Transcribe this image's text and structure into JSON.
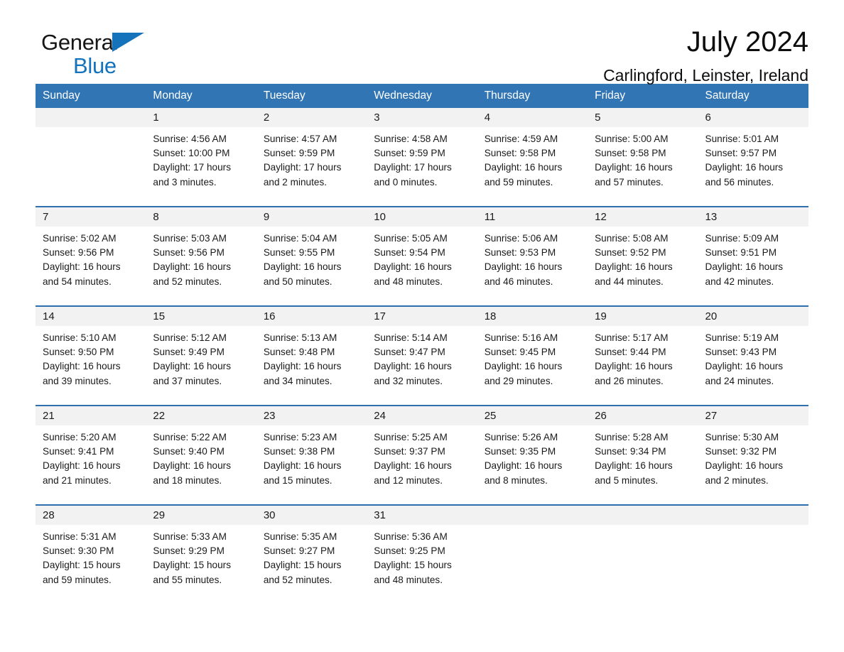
{
  "brand": {
    "name_part1": "General",
    "name_part2": "Blue",
    "accent_color": "#1573bb",
    "flag_icon": "triangle-flag-icon"
  },
  "header": {
    "title": "July 2024",
    "subtitle": "Carlingford, Leinster, Ireland"
  },
  "calendar": {
    "header_bg": "#3275b5",
    "row_divider_color": "#2f6fae",
    "daynum_band_bg": "#f2f2f2",
    "weekday_headers": [
      "Sunday",
      "Monday",
      "Tuesday",
      "Wednesday",
      "Thursday",
      "Friday",
      "Saturday"
    ],
    "weeks": [
      [
        {
          "day": "",
          "sunrise": "",
          "sunset": "",
          "daylight_line1": "",
          "daylight_line2": "",
          "blank": true
        },
        {
          "day": "1",
          "sunrise": "Sunrise: 4:56 AM",
          "sunset": "Sunset: 10:00 PM",
          "daylight_line1": "Daylight: 17 hours",
          "daylight_line2": "and 3 minutes."
        },
        {
          "day": "2",
          "sunrise": "Sunrise: 4:57 AM",
          "sunset": "Sunset: 9:59 PM",
          "daylight_line1": "Daylight: 17 hours",
          "daylight_line2": "and 2 minutes."
        },
        {
          "day": "3",
          "sunrise": "Sunrise: 4:58 AM",
          "sunset": "Sunset: 9:59 PM",
          "daylight_line1": "Daylight: 17 hours",
          "daylight_line2": "and 0 minutes."
        },
        {
          "day": "4",
          "sunrise": "Sunrise: 4:59 AM",
          "sunset": "Sunset: 9:58 PM",
          "daylight_line1": "Daylight: 16 hours",
          "daylight_line2": "and 59 minutes."
        },
        {
          "day": "5",
          "sunrise": "Sunrise: 5:00 AM",
          "sunset": "Sunset: 9:58 PM",
          "daylight_line1": "Daylight: 16 hours",
          "daylight_line2": "and 57 minutes."
        },
        {
          "day": "6",
          "sunrise": "Sunrise: 5:01 AM",
          "sunset": "Sunset: 9:57 PM",
          "daylight_line1": "Daylight: 16 hours",
          "daylight_line2": "and 56 minutes."
        }
      ],
      [
        {
          "day": "7",
          "sunrise": "Sunrise: 5:02 AM",
          "sunset": "Sunset: 9:56 PM",
          "daylight_line1": "Daylight: 16 hours",
          "daylight_line2": "and 54 minutes."
        },
        {
          "day": "8",
          "sunrise": "Sunrise: 5:03 AM",
          "sunset": "Sunset: 9:56 PM",
          "daylight_line1": "Daylight: 16 hours",
          "daylight_line2": "and 52 minutes."
        },
        {
          "day": "9",
          "sunrise": "Sunrise: 5:04 AM",
          "sunset": "Sunset: 9:55 PM",
          "daylight_line1": "Daylight: 16 hours",
          "daylight_line2": "and 50 minutes."
        },
        {
          "day": "10",
          "sunrise": "Sunrise: 5:05 AM",
          "sunset": "Sunset: 9:54 PM",
          "daylight_line1": "Daylight: 16 hours",
          "daylight_line2": "and 48 minutes."
        },
        {
          "day": "11",
          "sunrise": "Sunrise: 5:06 AM",
          "sunset": "Sunset: 9:53 PM",
          "daylight_line1": "Daylight: 16 hours",
          "daylight_line2": "and 46 minutes."
        },
        {
          "day": "12",
          "sunrise": "Sunrise: 5:08 AM",
          "sunset": "Sunset: 9:52 PM",
          "daylight_line1": "Daylight: 16 hours",
          "daylight_line2": "and 44 minutes."
        },
        {
          "day": "13",
          "sunrise": "Sunrise: 5:09 AM",
          "sunset": "Sunset: 9:51 PM",
          "daylight_line1": "Daylight: 16 hours",
          "daylight_line2": "and 42 minutes."
        }
      ],
      [
        {
          "day": "14",
          "sunrise": "Sunrise: 5:10 AM",
          "sunset": "Sunset: 9:50 PM",
          "daylight_line1": "Daylight: 16 hours",
          "daylight_line2": "and 39 minutes."
        },
        {
          "day": "15",
          "sunrise": "Sunrise: 5:12 AM",
          "sunset": "Sunset: 9:49 PM",
          "daylight_line1": "Daylight: 16 hours",
          "daylight_line2": "and 37 minutes."
        },
        {
          "day": "16",
          "sunrise": "Sunrise: 5:13 AM",
          "sunset": "Sunset: 9:48 PM",
          "daylight_line1": "Daylight: 16 hours",
          "daylight_line2": "and 34 minutes."
        },
        {
          "day": "17",
          "sunrise": "Sunrise: 5:14 AM",
          "sunset": "Sunset: 9:47 PM",
          "daylight_line1": "Daylight: 16 hours",
          "daylight_line2": "and 32 minutes."
        },
        {
          "day": "18",
          "sunrise": "Sunrise: 5:16 AM",
          "sunset": "Sunset: 9:45 PM",
          "daylight_line1": "Daylight: 16 hours",
          "daylight_line2": "and 29 minutes."
        },
        {
          "day": "19",
          "sunrise": "Sunrise: 5:17 AM",
          "sunset": "Sunset: 9:44 PM",
          "daylight_line1": "Daylight: 16 hours",
          "daylight_line2": "and 26 minutes."
        },
        {
          "day": "20",
          "sunrise": "Sunrise: 5:19 AM",
          "sunset": "Sunset: 9:43 PM",
          "daylight_line1": "Daylight: 16 hours",
          "daylight_line2": "and 24 minutes."
        }
      ],
      [
        {
          "day": "21",
          "sunrise": "Sunrise: 5:20 AM",
          "sunset": "Sunset: 9:41 PM",
          "daylight_line1": "Daylight: 16 hours",
          "daylight_line2": "and 21 minutes."
        },
        {
          "day": "22",
          "sunrise": "Sunrise: 5:22 AM",
          "sunset": "Sunset: 9:40 PM",
          "daylight_line1": "Daylight: 16 hours",
          "daylight_line2": "and 18 minutes."
        },
        {
          "day": "23",
          "sunrise": "Sunrise: 5:23 AM",
          "sunset": "Sunset: 9:38 PM",
          "daylight_line1": "Daylight: 16 hours",
          "daylight_line2": "and 15 minutes."
        },
        {
          "day": "24",
          "sunrise": "Sunrise: 5:25 AM",
          "sunset": "Sunset: 9:37 PM",
          "daylight_line1": "Daylight: 16 hours",
          "daylight_line2": "and 12 minutes."
        },
        {
          "day": "25",
          "sunrise": "Sunrise: 5:26 AM",
          "sunset": "Sunset: 9:35 PM",
          "daylight_line1": "Daylight: 16 hours",
          "daylight_line2": "and 8 minutes."
        },
        {
          "day": "26",
          "sunrise": "Sunrise: 5:28 AM",
          "sunset": "Sunset: 9:34 PM",
          "daylight_line1": "Daylight: 16 hours",
          "daylight_line2": "and 5 minutes."
        },
        {
          "day": "27",
          "sunrise": "Sunrise: 5:30 AM",
          "sunset": "Sunset: 9:32 PM",
          "daylight_line1": "Daylight: 16 hours",
          "daylight_line2": "and 2 minutes."
        }
      ],
      [
        {
          "day": "28",
          "sunrise": "Sunrise: 5:31 AM",
          "sunset": "Sunset: 9:30 PM",
          "daylight_line1": "Daylight: 15 hours",
          "daylight_line2": "and 59 minutes."
        },
        {
          "day": "29",
          "sunrise": "Sunrise: 5:33 AM",
          "sunset": "Sunset: 9:29 PM",
          "daylight_line1": "Daylight: 15 hours",
          "daylight_line2": "and 55 minutes."
        },
        {
          "day": "30",
          "sunrise": "Sunrise: 5:35 AM",
          "sunset": "Sunset: 9:27 PM",
          "daylight_line1": "Daylight: 15 hours",
          "daylight_line2": "and 52 minutes."
        },
        {
          "day": "31",
          "sunrise": "Sunrise: 5:36 AM",
          "sunset": "Sunset: 9:25 PM",
          "daylight_line1": "Daylight: 15 hours",
          "daylight_line2": "and 48 minutes."
        },
        {
          "day": "",
          "sunrise": "",
          "sunset": "",
          "daylight_line1": "",
          "daylight_line2": "",
          "blank": true
        },
        {
          "day": "",
          "sunrise": "",
          "sunset": "",
          "daylight_line1": "",
          "daylight_line2": "",
          "blank": true
        },
        {
          "day": "",
          "sunrise": "",
          "sunset": "",
          "daylight_line1": "",
          "daylight_line2": "",
          "blank": true
        }
      ]
    ]
  }
}
